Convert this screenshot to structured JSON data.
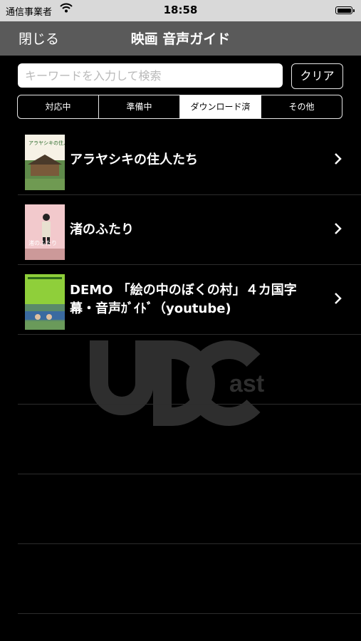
{
  "status": {
    "carrier": "通信事業者",
    "time": "18:58"
  },
  "nav": {
    "close": "閉じる",
    "title": "映画 音声ガイド"
  },
  "search": {
    "placeholder": "キーワードを入力して検索",
    "value": "",
    "clear": "クリア"
  },
  "segments": [
    {
      "label": "対応中",
      "selected": false
    },
    {
      "label": "準備中",
      "selected": false
    },
    {
      "label": "ダウンロード済",
      "selected": true
    },
    {
      "label": "その他",
      "selected": false
    }
  ],
  "items": [
    {
      "title": "アラヤシキの住人たち",
      "poster_text": "アラヤシキの住人たち"
    },
    {
      "title": "渚のふたり",
      "poster_text": "渚のふたり"
    },
    {
      "title": "DEMO 「絵の中のぼくの村」４カ国字幕・音声ｶﾞｲﾄﾞ（youtube)"
    }
  ],
  "watermark": {
    "main": "UDC",
    "sub": "ast"
  },
  "colors": {
    "navbar": "#5a5a5a",
    "statusbar": "#d9d9d9",
    "background": "#000000"
  }
}
